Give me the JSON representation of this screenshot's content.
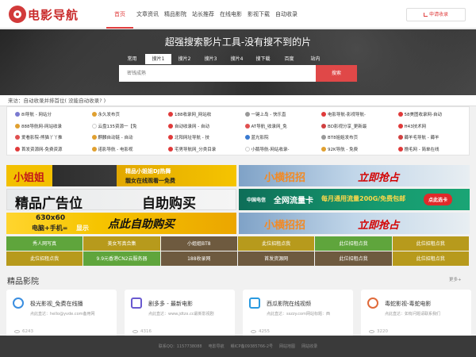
{
  "header": {
    "logo_text": "电影导航",
    "nav": [
      "首页",
      "文章资讯",
      "精品影院",
      "站长推荐",
      "在线电影",
      "影视下载",
      "自动收录"
    ],
    "submit_label": "申请收录"
  },
  "hero": {
    "title": "超强搜索影片工具-没有搜不到的片",
    "tabs": [
      "常用",
      "搜片1",
      "搜片2",
      "搜片3",
      "搜片4",
      "搜下载",
      "百度",
      "站内"
    ],
    "active_tab": 1,
    "search_placeholder": "密钱成熟",
    "search_button": "搜索"
  },
  "recent_text": "来访：自动收录并排首位( 没能自动收录? )",
  "links": [
    {
      "text": "8l导航 - 网站分",
      "color": "#7a7ad0"
    },
    {
      "text": "永久发布页",
      "color": "#e0a030"
    },
    {
      "text": "188收录网_网站收",
      "color": "#e03a3a"
    },
    {
      "text": "一键上岛 - 快乐直",
      "color": "#999999"
    },
    {
      "text": "电影导航-影视导航-",
      "color": "#e03a3a"
    },
    {
      "text": "58美图收录网-自动",
      "color": "#e03a3a"
    },
    {
      "text": "888导航网-网站收录",
      "color": "#e0a030"
    },
    {
      "text": "云盘135资源一【免",
      "color": "#ffffff"
    },
    {
      "text": "自动收录网 - 自动",
      "color": "#e03a3a"
    },
    {
      "text": "AT导航_收录网_免",
      "color": "#e05050"
    },
    {
      "text": "BD影视分享_更新最",
      "color": "#d04040"
    },
    {
      "text": "H43技术网",
      "color": "#e03a3a"
    },
    {
      "text": "爱看影院-熊猫丫丫推",
      "color": "#e05050"
    },
    {
      "text": "麒麟自动链 - 自动",
      "color": "#e0a030"
    },
    {
      "text": "北阳网址导航 - 技",
      "color": "#e03a3a"
    },
    {
      "text": "蓝光影院",
      "color": "#3a7ad0"
    },
    {
      "text": "BT8姐姐发布页",
      "color": "#999999"
    },
    {
      "text": "薅羊毛导航 - 薅羊",
      "color": "#d04040"
    },
    {
      "text": "首发资源网-免费资源",
      "color": "#e03a3a"
    },
    {
      "text": "诺影导航 - 电影视",
      "color": "#e0a030"
    },
    {
      "text": "宅男导航网_分类目录",
      "color": "#e03a3a"
    },
    {
      "text": "小鹅导航-网站收录-",
      "color": "#ffffff"
    },
    {
      "text": "92K导航 - 免费",
      "color": "#e0a030"
    },
    {
      "text": "撸毛网 - 简单在线",
      "color": "#e03a3a"
    }
  ],
  "ads": {
    "row1_left_a": "小姐姐",
    "row1_left_b": "精品小姐姐DJ热舞",
    "row1_left_c": "靓女在线观看一免费",
    "row1_right_a": "小横招招",
    "row1_right_b": "立即抢占",
    "row2_left_a": "精品广告位",
    "row2_left_b": "自助购买",
    "row2_right_a": "中国电信",
    "row2_right_b": "全网流量卡",
    "row2_right_c": "每月通用流量200G/免费包邮",
    "row2_right_d": "点此选卡",
    "row3_left_a": "630x60",
    "row3_left_b": "电脑+手机=",
    "row3_left_c": "显示",
    "row3_left_d": "点此自助购买",
    "row3_right_a": "小横招招",
    "row3_right_b": "立即抢占"
  },
  "tags_row1": [
    {
      "label": "秀人网写真",
      "color": "#5fa53c"
    },
    {
      "label": "美女写真合集",
      "color": "#b79a1c"
    },
    {
      "label": "小姐姐BT8",
      "color": "#6e5a3f"
    },
    {
      "label": "此位招租点我",
      "color": "#b79a1c"
    },
    {
      "label": "此位招租点我",
      "color": "#5fa53c"
    },
    {
      "label": "此位招租点我",
      "color": "#b79a1c"
    }
  ],
  "tags_row2": [
    {
      "label": "此位招租点我",
      "color": "#b79a1c"
    },
    {
      "label": "9.9元香港CN2云服务器",
      "color": "#5fa53c"
    },
    {
      "label": "188收录网",
      "color": "#6e5a3f"
    },
    {
      "label": "首发资源网",
      "color": "#6e5a3f"
    },
    {
      "label": "此位招租点我",
      "color": "#6e5a3f"
    },
    {
      "label": "此位招租点我",
      "color": "#b79a1c"
    }
  ],
  "section": {
    "title": "精品影院",
    "more": "更多+"
  },
  "cards": [
    {
      "name": "极光影视_免费在线播",
      "desc": "点此直达：hello@yvde.com备用网",
      "views": "6243",
      "color": "#3a8ee0",
      "icon": "aurora-icon"
    },
    {
      "name": "剧多多 - 最新电影",
      "desc": "点此直达：www.jdtzx.cc最新影视剧",
      "views": "4316",
      "color": "#6a5ad0",
      "icon": "play-icon"
    },
    {
      "name": "西瓜影院在线视频",
      "desc": "点此直达：sszzy.com网站标题：西",
      "views": "4255",
      "color": "#2a9ae0",
      "icon": "robot-icon"
    },
    {
      "name": "毒蛇影视-毒蛇电影",
      "desc": "点此直达：如有问题请联系我们",
      "views": "3220",
      "color": "#e06a3a",
      "icon": "snake-icon"
    }
  ],
  "footer": [
    "联系QQ：1157738088",
    "电影导航",
    "赣ICP备09385766-2号",
    "网站地图",
    "网站收录"
  ]
}
